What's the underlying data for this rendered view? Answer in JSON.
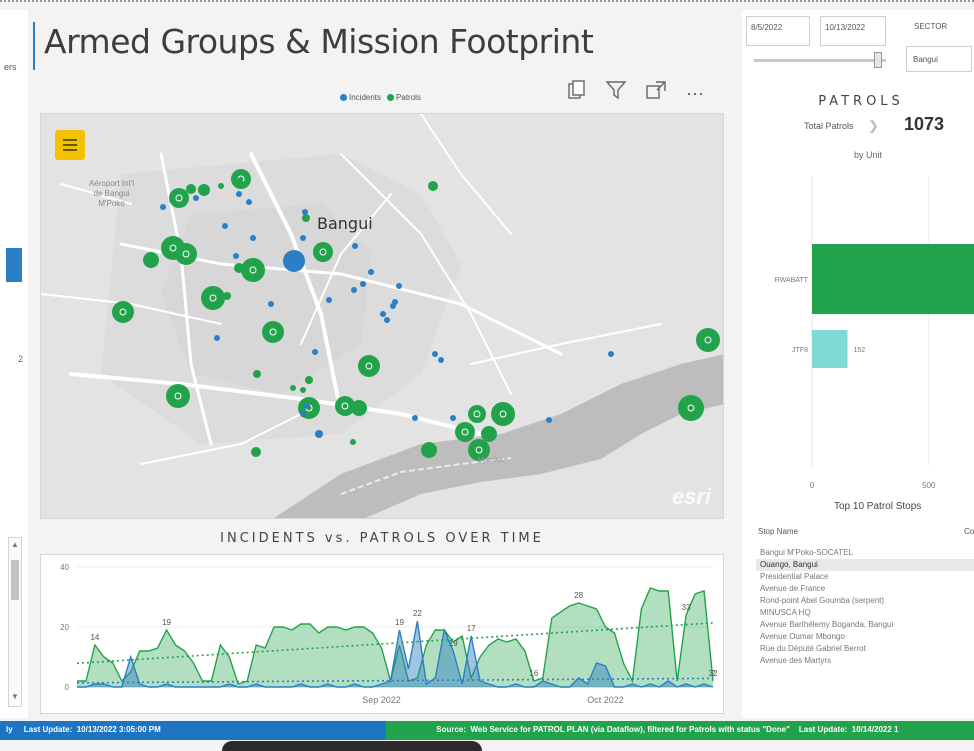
{
  "left_sliver": {
    "partial_text": "ers",
    "partial_number": "2"
  },
  "title": "Armed Groups & Mission Footprint",
  "legend": {
    "incidents": "Incidents",
    "patrols": "Patrols",
    "incidents_color": "#2a7fc5",
    "patrols_color": "#22a34b"
  },
  "toolbar": {
    "copy_icon": "copy-icon",
    "filter_icon": "filter-icon",
    "focus_icon": "focus-mode-icon",
    "more_label": "···"
  },
  "map": {
    "city": "Bangui",
    "airport_line1": "Aéroport Int'l",
    "airport_line2": "de Bangui",
    "airport_line3": "M'Poko",
    "river_label": "Mposha",
    "basemap_logo": "esri"
  },
  "chart_data": {
    "type": "area",
    "title": "INCIDENTS vs. PATROLS OVER TIME",
    "xlabel": "",
    "ylabel": "",
    "ylim": [
      0,
      40
    ],
    "yticks": [
      0,
      20,
      40
    ],
    "xtick_labels": [
      "Sep 2022",
      "Oct 2022"
    ],
    "x": [
      "Aug 5",
      "Aug 6",
      "Aug 7",
      "Aug 8",
      "Aug 9",
      "Aug 10",
      "Aug 11",
      "Aug 12",
      "Aug 13",
      "Aug 14",
      "Aug 15",
      "Aug 16",
      "Aug 17",
      "Aug 18",
      "Aug 19",
      "Aug 20",
      "Aug 21",
      "Aug 22",
      "Aug 23",
      "Aug 24",
      "Aug 25",
      "Aug 26",
      "Aug 27",
      "Aug 28",
      "Aug 29",
      "Aug 30",
      "Aug 31",
      "Sep 1",
      "Sep 2",
      "Sep 3",
      "Sep 4",
      "Sep 5",
      "Sep 6",
      "Sep 7",
      "Sep 8",
      "Sep 9",
      "Sep 10",
      "Sep 11",
      "Sep 12",
      "Sep 13",
      "Sep 14",
      "Sep 15",
      "Sep 16",
      "Sep 17",
      "Sep 18",
      "Sep 19",
      "Sep 20",
      "Sep 21",
      "Sep 22",
      "Sep 23",
      "Sep 24",
      "Sep 25",
      "Sep 26",
      "Sep 27",
      "Sep 28",
      "Sep 29",
      "Sep 30",
      "Oct 1",
      "Oct 2",
      "Oct 3",
      "Oct 4",
      "Oct 5",
      "Oct 6",
      "Oct 7",
      "Oct 8",
      "Oct 9",
      "Oct 10",
      "Oct 11",
      "Oct 12",
      "Oct 13",
      "Oct 14",
      "Oct 15"
    ],
    "series": [
      {
        "name": "Patrols",
        "color": "#22a34b",
        "values": [
          2,
          2,
          14,
          10,
          8,
          2,
          5,
          12,
          12,
          13,
          19,
          14,
          12,
          8,
          2,
          2,
          14,
          10,
          1,
          2,
          14,
          13,
          20,
          20,
          19,
          21,
          21,
          18,
          20,
          20,
          19,
          20,
          20,
          18,
          13,
          2,
          14,
          2,
          3,
          14,
          19,
          19,
          15,
          17,
          3,
          10,
          14,
          16,
          15,
          16,
          12,
          2,
          3,
          23,
          25,
          27,
          28,
          27,
          26,
          20,
          18,
          8,
          2,
          26,
          33,
          32,
          32,
          2,
          24,
          31,
          32,
          2
        ]
      },
      {
        "name": "Incidents",
        "color": "#2a7fc5",
        "values": [
          0,
          0,
          1,
          1,
          0,
          0,
          10,
          1,
          0,
          0,
          1,
          0,
          0,
          0,
          0,
          0,
          0,
          1,
          0,
          0,
          1,
          0,
          0,
          0,
          0,
          1,
          0,
          0,
          1,
          0,
          0,
          1,
          0,
          0,
          1,
          2,
          19,
          6,
          22,
          1,
          3,
          19,
          12,
          1,
          17,
          2,
          1,
          0,
          0,
          1,
          0,
          0,
          2,
          1,
          0,
          0,
          3,
          1,
          8,
          7,
          0,
          0,
          1,
          0,
          1,
          0,
          2,
          0,
          1,
          0,
          1,
          0
        ]
      }
    ],
    "data_labels": [
      {
        "series": "Patrols",
        "x": "Aug 7",
        "text": "14"
      },
      {
        "series": "Patrols",
        "x": "Aug 15",
        "text": "19"
      },
      {
        "series": "Incidents",
        "x": "Sep 10",
        "text": "19"
      },
      {
        "series": "Incidents",
        "x": "Sep 12",
        "text": "22"
      },
      {
        "series": "Incidents",
        "x": "Sep 16",
        "text": "19"
      },
      {
        "series": "Incidents",
        "x": "Sep 18",
        "text": "17"
      },
      {
        "series": "Patrols",
        "x": "Sep 25",
        "text": "16"
      },
      {
        "series": "Patrols",
        "x": "Sep 30",
        "text": "28"
      },
      {
        "series": "Patrols",
        "x": "Oct 12",
        "text": "33"
      },
      {
        "series": "Patrols",
        "x": "Oct 15",
        "text": "32"
      },
      {
        "series": "Patrols",
        "x": "Oct 15",
        "text": "2"
      }
    ],
    "trendline": true,
    "grid": false,
    "legend": "none"
  },
  "filters": {
    "start_date": "8/5/2022",
    "end_date": "10/13/2022",
    "sector_label": "SECTOR",
    "sector_value": "Bangui"
  },
  "patrols_panel": {
    "header": "PATROLS",
    "total_label": "Total Patrols",
    "total_value": "1073",
    "by_unit_title": "by Unit",
    "units": [
      {
        "name": "RWABATT",
        "value": 921
      },
      {
        "name": "JTF8",
        "value": 152
      }
    ],
    "xticks": [
      0,
      500
    ],
    "top10_title": "Top 10 Patrol Stops",
    "stops_col1": "Stop Name",
    "stops_col2": "Co",
    "stops": [
      "Bangui M'Poko-SOCATEL",
      "Ouango, Bangui",
      "Presidential Palace",
      "Avenue de France",
      "Rond-point Abel Goumba (serpent)",
      "MINUSCA HQ",
      "Avenue Barthélemy Boganda, Bangui",
      "Avenue Oumar Mbongo",
      "Rue du Député Gabriel Berrot",
      "Avenue des Martyrs"
    ],
    "selected_stop": 1
  },
  "status": {
    "left_prefix": "ly",
    "left_label": "Last Update:",
    "left_value": "10/13/2022 3:05:00 PM",
    "source_label": "Source:",
    "source_text": "Web Service for PATROL PLAN (via Dataflow), filtered for Patrols with status \"Done\"",
    "right_label": "Last Update:",
    "right_value": "10/14/2022 1"
  }
}
